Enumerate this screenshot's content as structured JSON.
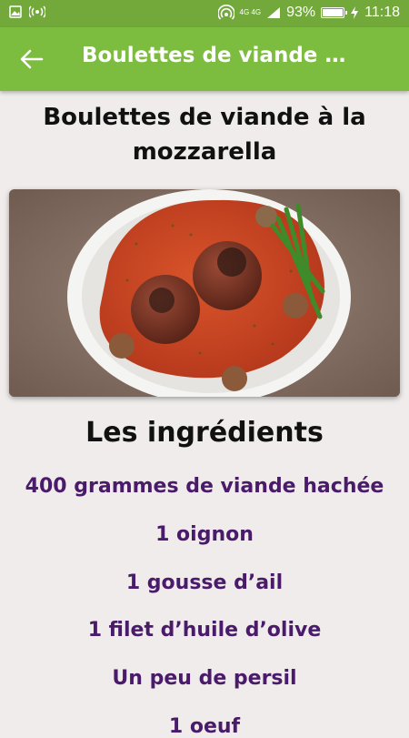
{
  "status_bar": {
    "network": "4G 4G",
    "battery": "93%",
    "battery_level": 0.93,
    "time": "11:18"
  },
  "app_bar": {
    "title": "Boulettes de viande à la ..."
  },
  "recipe": {
    "title": "Boulettes de viande à la mozzarella",
    "image_subject": "meatballs in tomato sauce with green beans",
    "ingredients_heading": "Les ingrédients",
    "ingredients": [
      "400 grammes de viande hachée",
      "1 oignon",
      "1 gousse d’ail",
      "1 filet d’huile d’olive",
      "Un peu de persil",
      "1 oeuf"
    ]
  },
  "colors": {
    "status_bar": "#72a93a",
    "app_bar": "#7cbc3f",
    "ingredient_text": "#4a1a6b"
  }
}
